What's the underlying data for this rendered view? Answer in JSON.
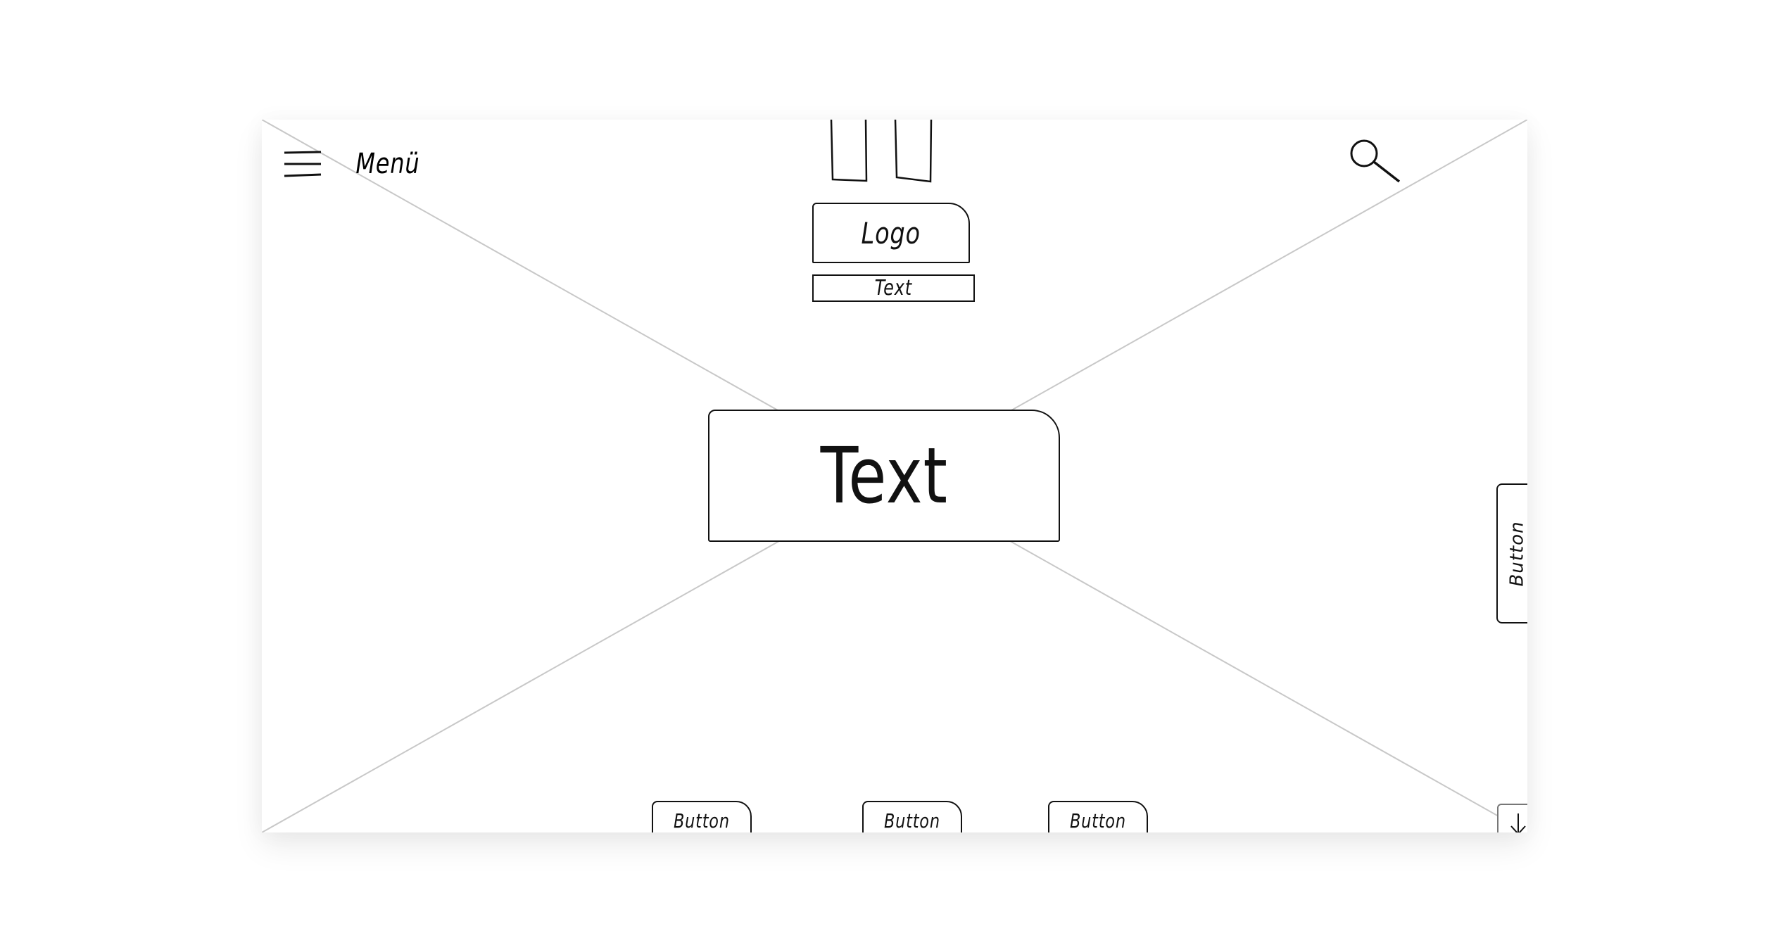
{
  "header": {
    "menu_label": "Menü",
    "menu_icon": "hamburger-icon",
    "search_icon": "magnifier-icon"
  },
  "logo": {
    "label": "Logo",
    "subtitle": "Text"
  },
  "hero": {
    "title": "Text"
  },
  "side_button": {
    "label": "Button"
  },
  "bottom_buttons": [
    {
      "label": "Button"
    },
    {
      "label": "Button"
    },
    {
      "label": "Button"
    }
  ],
  "scroll_icon": "arrow-down-icon",
  "colors": {
    "stroke": "#111111",
    "placeholder_lines": "#c8c8c8",
    "background": "#ffffff"
  }
}
